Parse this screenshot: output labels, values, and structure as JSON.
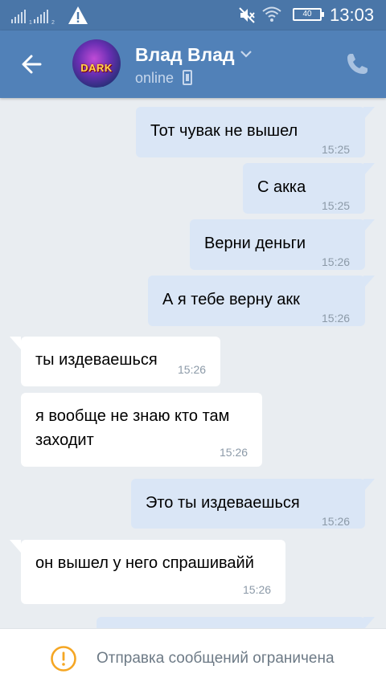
{
  "status_bar": {
    "time": "13:03",
    "battery": "40",
    "icons": [
      "signal-icon",
      "warning-icon",
      "mute-icon",
      "wifi-icon",
      "battery-icon"
    ]
  },
  "header": {
    "contact_name": "Влад Влад",
    "status": "online",
    "avatar_text": "DARK",
    "icons": [
      "back-arrow-icon",
      "chevron-down-icon",
      "mobile-icon",
      "phone-icon"
    ]
  },
  "messages": [
    {
      "dir": "out",
      "text": "Тот чувак не вышел",
      "time": "15:25"
    },
    {
      "dir": "out",
      "text": "С акка",
      "time": "15:25"
    },
    {
      "dir": "out",
      "text": "Верни деньги",
      "time": "15:26"
    },
    {
      "dir": "out",
      "text": "А я тебе верну акк",
      "time": "15:26"
    },
    {
      "dir": "in",
      "text": "ты издеваешься",
      "time": "15:26"
    },
    {
      "dir": "in",
      "lines": [
        "я вообще не знаю кто там",
        "заходит"
      ],
      "time": "15:26"
    },
    {
      "dir": "out",
      "text": "Это ты издеваешься",
      "time": "15:26"
    },
    {
      "dir": "in",
      "text": "он вышел у него спрашивайй",
      "time": "15:26"
    }
  ],
  "bottom_bar": {
    "text": "Отправка сообщений ограничена",
    "icon": "warning-circle-icon"
  },
  "colors": {
    "statusbar": "#4a76a8",
    "header": "#5181b8",
    "chat_background": "#e9edf1",
    "outgoing_bubble": "#dae6f6",
    "incoming_bubble": "#ffffff",
    "warning": "#f5a623"
  }
}
